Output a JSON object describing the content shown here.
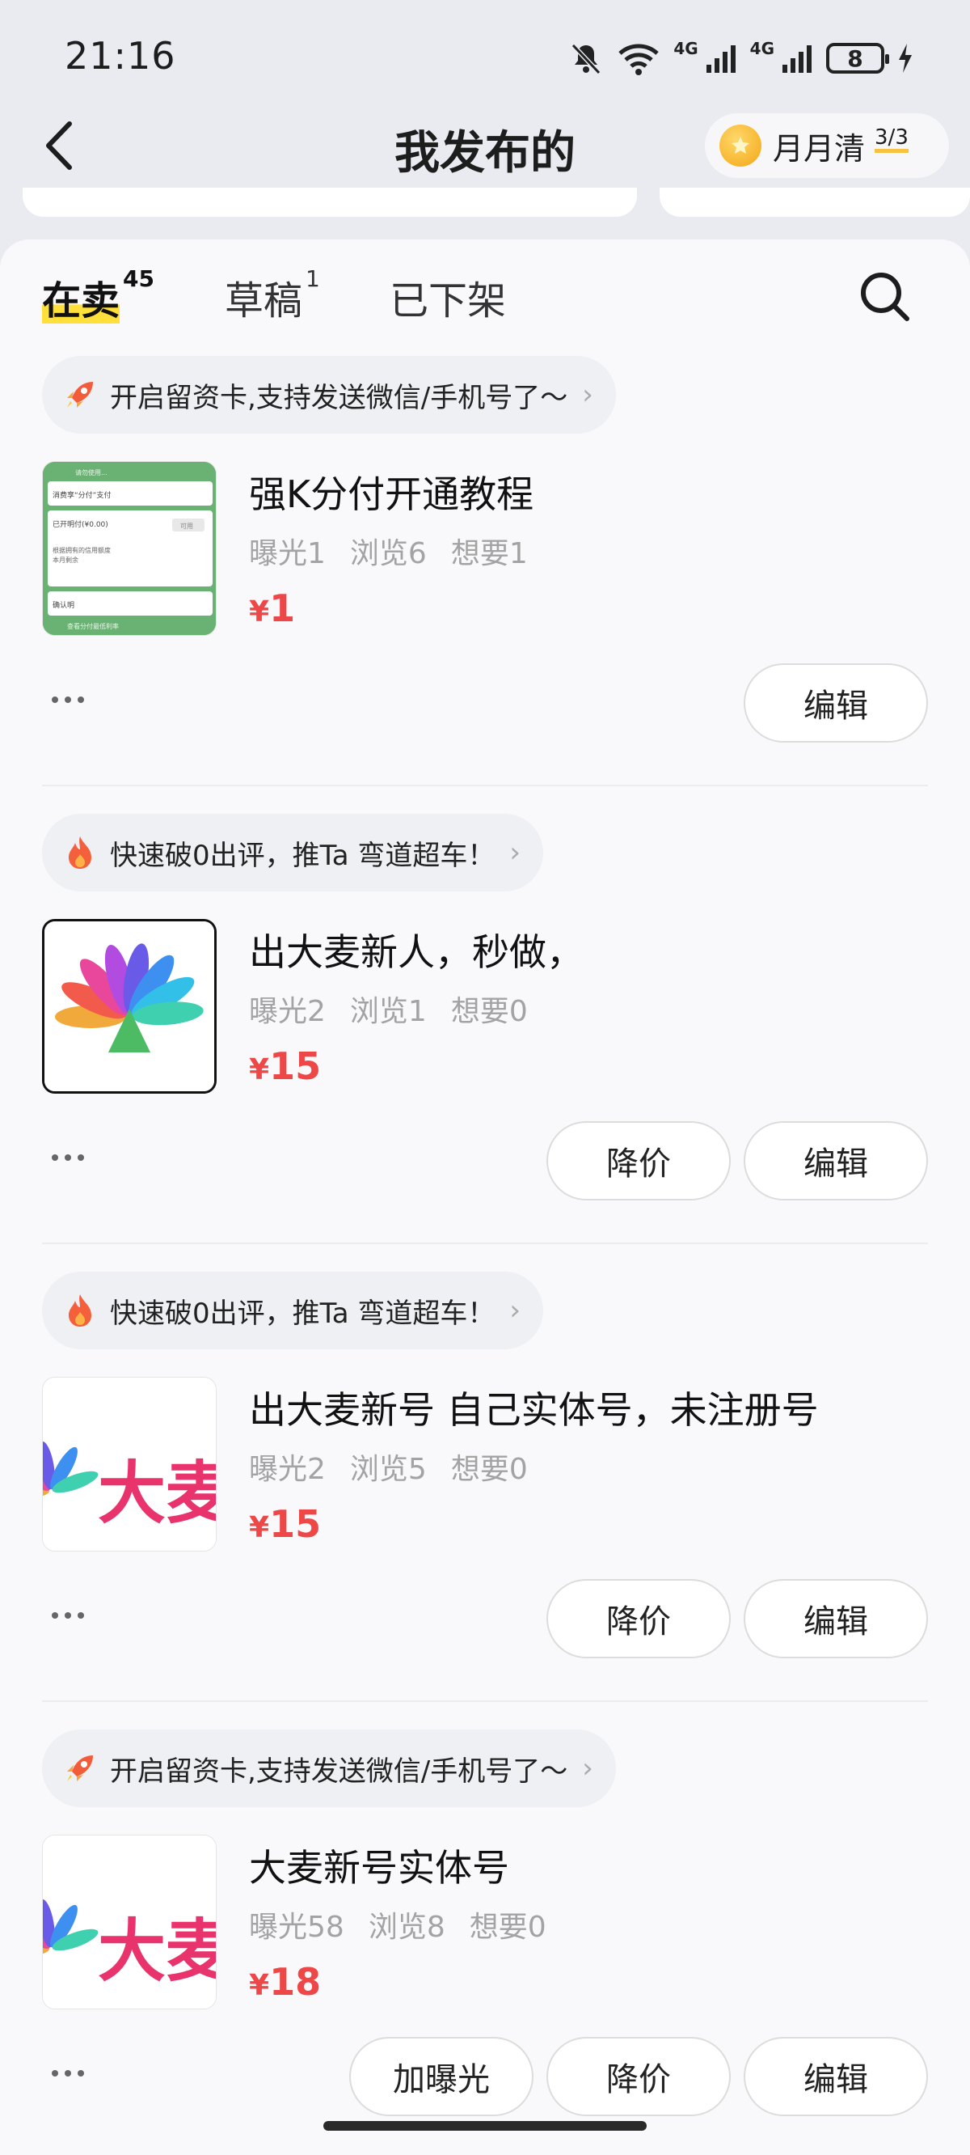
{
  "status_bar": {
    "time": "21:16",
    "network1": "4G",
    "network2": "4G",
    "battery": "8"
  },
  "header": {
    "title": "我发布的",
    "monthly_label": "月月清",
    "monthly_count": "3/3"
  },
  "tabs": [
    {
      "label": "在卖",
      "count": "45",
      "active": true
    },
    {
      "label": "草稿",
      "count": "1",
      "active": false
    },
    {
      "label": "已下架",
      "count": "",
      "active": false
    }
  ],
  "items": [
    {
      "promo": "开启留资卡,支持发送微信/手机号了～",
      "promo_icon": "rocket-icon",
      "title": "强K分付开通教程",
      "exposure": "曝光1",
      "views": "浏览6",
      "wants": "想要1",
      "price": "1",
      "thumb": "green-screenshot",
      "buttons": [
        "编辑"
      ]
    },
    {
      "promo": "快速破0出评，推Ta 弯道超车！",
      "promo_icon": "fire-icon",
      "title": "出大麦新人，秒做，",
      "exposure": "曝光2",
      "views": "浏览1",
      "wants": "想要0",
      "price": "15",
      "thumb": "damai-logo",
      "buttons": [
        "降价",
        "编辑"
      ]
    },
    {
      "promo": "快速破0出评，推Ta 弯道超车！",
      "promo_icon": "fire-icon",
      "title": "出大麦新号 自己实体号，未注册号",
      "exposure": "曝光2",
      "views": "浏览5",
      "wants": "想要0",
      "price": "15",
      "thumb": "damai-text",
      "thumb_text": "大麦",
      "buttons": [
        "降价",
        "编辑"
      ]
    },
    {
      "promo": "开启留资卡,支持发送微信/手机号了～",
      "promo_icon": "rocket-icon",
      "title": "大麦新号实体号",
      "exposure": "曝光58",
      "views": "浏览8",
      "wants": "想要0",
      "price": "18",
      "thumb": "damai-text",
      "thumb_text": "大麦",
      "buttons": [
        "加曝光",
        "降价",
        "编辑"
      ]
    }
  ],
  "currency": "¥",
  "thumb_green_texts": [
    "请勿使用...",
    "消费享“分付”支付",
    "已开明付(¥0.00)",
    "可用",
    "根据拥有的信用额度",
    "本月剩余",
    "确认明",
    "查看分付最低利率"
  ],
  "colors": {
    "price": "#ee4747",
    "tab_highlight": "#ffe03a",
    "background": "#e9ebf1"
  }
}
